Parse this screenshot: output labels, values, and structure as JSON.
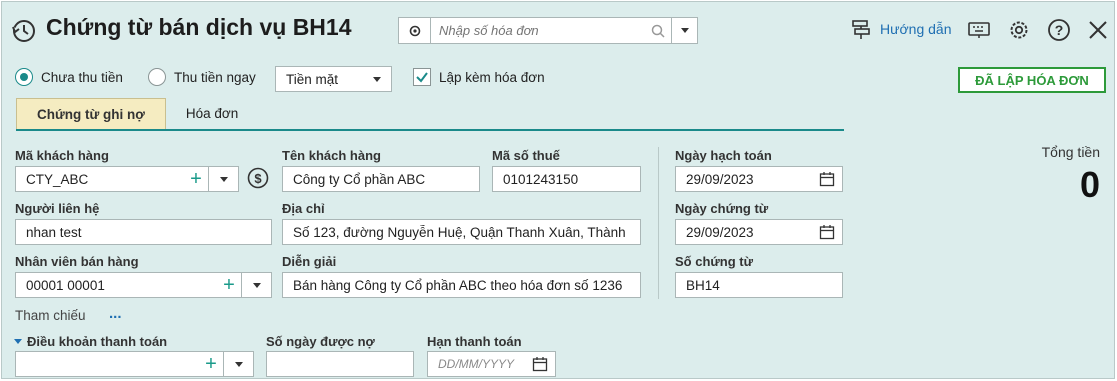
{
  "header": {
    "title": "Chứng từ bán dịch vụ BH14",
    "search_placeholder": "Nhập số hóa đơn",
    "guide_label": "Hướng dẫn"
  },
  "options": {
    "radio_unpaid": "Chưa thu tiền",
    "radio_paid_now": "Thu tiền ngay",
    "payment_method": "Tiền mặt",
    "checkbox_invoice": "Lập kèm hóa đơn",
    "invoiced_button": "ĐÃ LẬP HÓA ĐƠN"
  },
  "tabs": [
    {
      "label": "Chứng từ ghi nợ"
    },
    {
      "label": "Hóa đơn"
    }
  ],
  "form": {
    "customer_code": {
      "label": "Mã khách hàng",
      "value": "CTY_ABC"
    },
    "customer_name": {
      "label": "Tên khách hàng",
      "value": "Công ty Cổ phần ABC"
    },
    "tax_code": {
      "label": "Mã số thuế",
      "value": "0101243150"
    },
    "contact": {
      "label": "Người liên hệ",
      "value": "nhan test"
    },
    "address": {
      "label": "Địa chỉ",
      "value": "Số 123, đường Nguyễn Huệ, Quận Thanh Xuân, Thành"
    },
    "salesperson": {
      "label": "Nhân viên bán hàng",
      "value": "00001 00001"
    },
    "description": {
      "label": "Diễn giải",
      "value": "Bán hàng Công ty Cổ phần ABC theo hóa đơn số 1236"
    },
    "reference_label": "Tham chiếu",
    "reference_more": "...",
    "payment_terms": {
      "label": "Điều khoản thanh toán",
      "value": ""
    },
    "credit_days": {
      "label": "Số ngày được nợ",
      "value": ""
    },
    "due_date": {
      "label": "Hạn thanh toán",
      "placeholder": "DD/MM/YYYY"
    }
  },
  "dates": {
    "posting_date": {
      "label": "Ngày hạch toán",
      "value": "29/09/2023"
    },
    "voucher_date": {
      "label": "Ngày chứng từ",
      "value": "29/09/2023"
    },
    "voucher_no": {
      "label": "Số chứng từ",
      "value": "BH14"
    }
  },
  "total": {
    "label": "Tổng tiền",
    "value": "0"
  },
  "colors": {
    "accent": "#1a8a8a",
    "background": "#dcedec",
    "active_tab": "#f5ecc1",
    "success": "#2d9a3a",
    "link": "#1f6fb2"
  }
}
